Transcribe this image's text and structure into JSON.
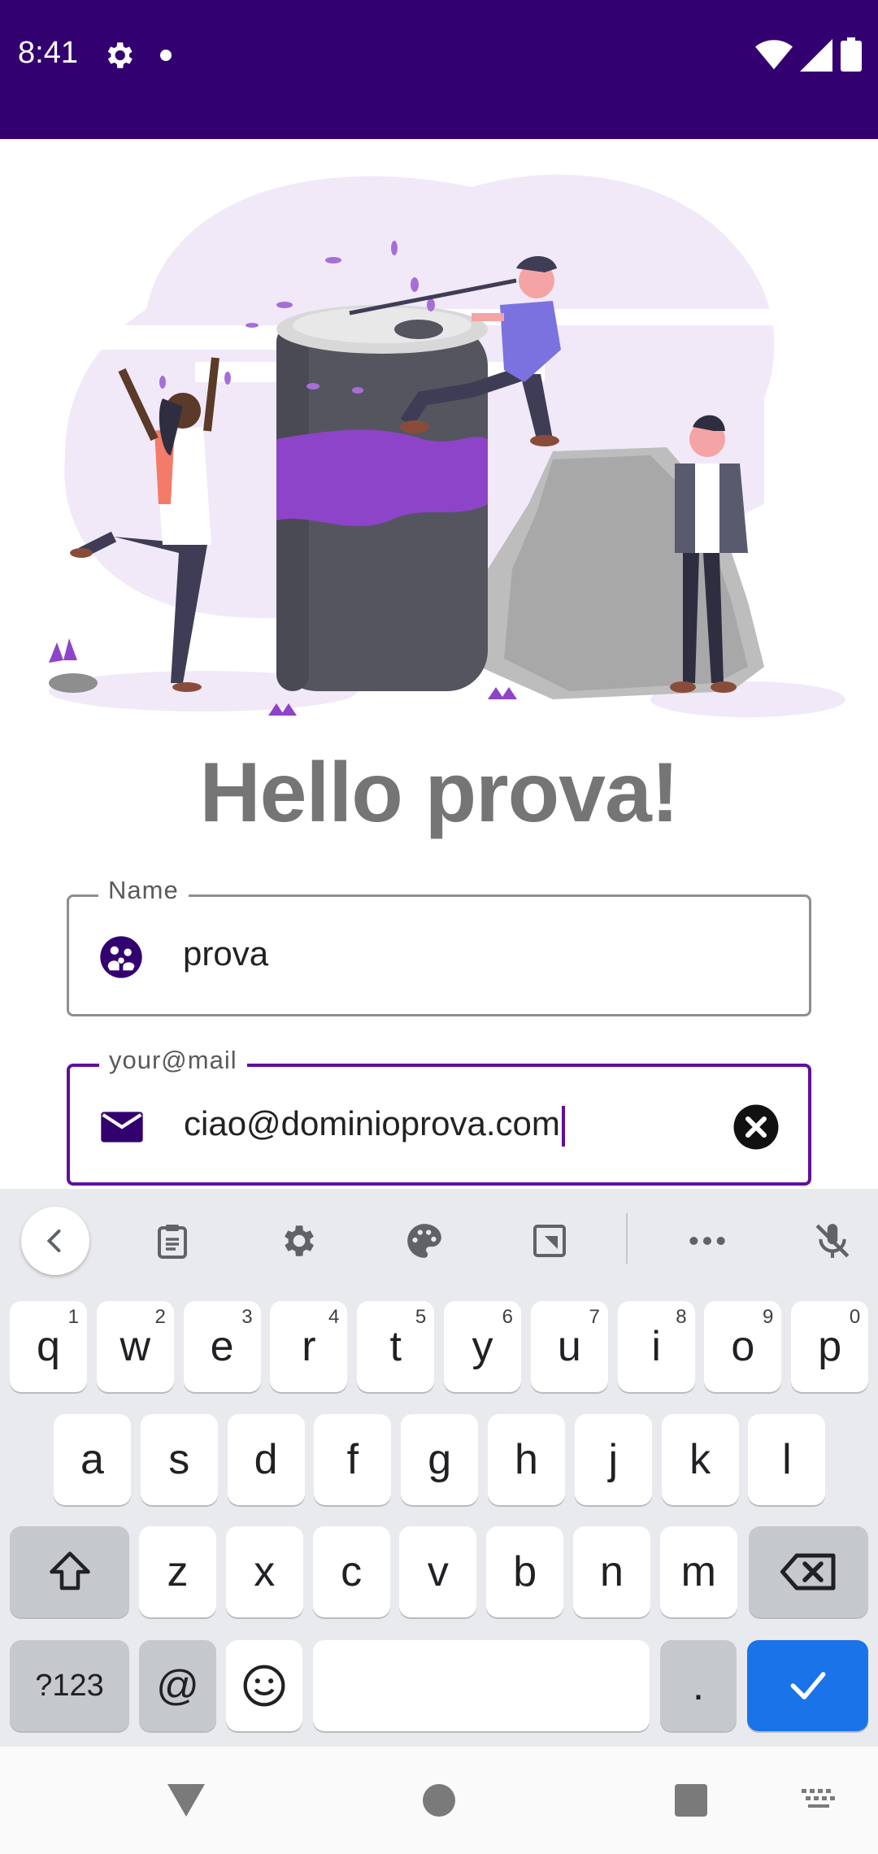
{
  "status_bar": {
    "time": "8:41",
    "settings_icon": "gear-icon",
    "dot_icon": "notification-dot-icon",
    "wifi_icon": "wifi-icon",
    "signal_icon": "signal-icon",
    "battery_icon": "battery-icon",
    "background": "#33006f"
  },
  "greeting": "Hello prova!",
  "name_field": {
    "label": "Name",
    "value": "prova",
    "icon": "family-icon"
  },
  "email_field": {
    "label": "your@mail",
    "value": "ciao@dominioprova.com",
    "icon": "mail-icon",
    "clear_icon": "clear-circle-icon",
    "accent": "#5f0fa0"
  },
  "keyboard": {
    "toolbar": [
      "back-chevron-icon",
      "clipboard-icon",
      "gear-icon",
      "palette-icon",
      "resize-icon",
      "more-icon",
      "mic-off-icon"
    ],
    "row1": [
      {
        "k": "q",
        "h": "1"
      },
      {
        "k": "w",
        "h": "2"
      },
      {
        "k": "e",
        "h": "3"
      },
      {
        "k": "r",
        "h": "4"
      },
      {
        "k": "t",
        "h": "5"
      },
      {
        "k": "y",
        "h": "6"
      },
      {
        "k": "u",
        "h": "7"
      },
      {
        "k": "i",
        "h": "8"
      },
      {
        "k": "o",
        "h": "9"
      },
      {
        "k": "p",
        "h": "0"
      }
    ],
    "row2": [
      "a",
      "s",
      "d",
      "f",
      "g",
      "h",
      "j",
      "k",
      "l"
    ],
    "row3": [
      "z",
      "x",
      "c",
      "v",
      "b",
      "n",
      "m"
    ],
    "symbols_key": "?123",
    "at_key": "@",
    "period_key": ".",
    "enter_color": "#1a73e8"
  },
  "nav_bar": [
    "back-triangle-icon",
    "home-circle-icon",
    "recents-square-icon",
    "keyboard-switch-icon"
  ]
}
